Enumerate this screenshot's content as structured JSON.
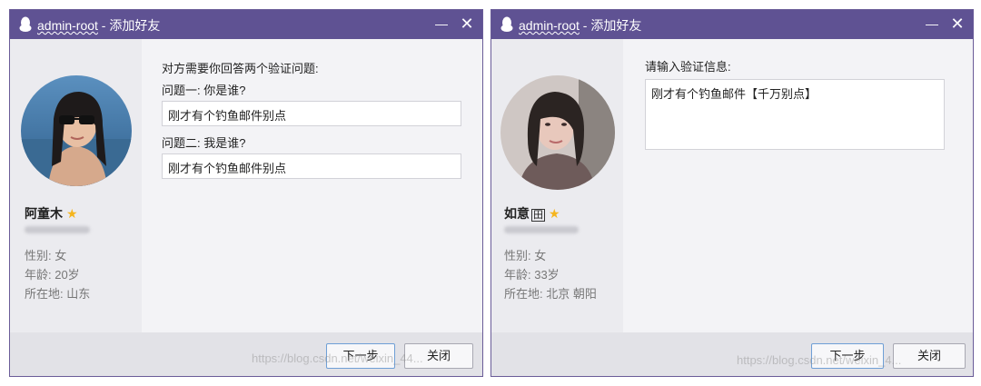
{
  "window_left": {
    "title_account": "admin-root",
    "title_sep": " - ",
    "title_action": "添加好友",
    "minimize_glyph": "—",
    "close_glyph": "✕",
    "profile": {
      "name": "阿童木",
      "star": "★",
      "gender": "性别: 女",
      "age": "年龄: 20岁",
      "location": "所在地:  山东"
    },
    "prompt": "对方需要你回答两个验证问题:",
    "question1_label": "问题一: 你是谁?",
    "question1_answer": "刚才有个钓鱼邮件别点",
    "question2_label": "问题二: 我是谁?",
    "question2_answer": "刚才有个钓鱼邮件别点",
    "next_button": "下一步",
    "close_button": "关闭",
    "watermark": "https://blog.csdn.net/weixin_44..."
  },
  "window_right": {
    "title_account": "admin-root",
    "title_sep": " - ",
    "title_action": "添加好友",
    "minimize_glyph": "—",
    "close_glyph": "✕",
    "profile": {
      "name": "如意",
      "badge": "田",
      "star": "★",
      "gender": "性别: 女",
      "age": "年龄: 33岁",
      "location": "所在地: 北京  朝阳"
    },
    "prompt": "请输入验证信息:",
    "verify_message": "刚才有个钓鱼邮件【千万别点】",
    "next_button": "下一步",
    "close_button": "关闭",
    "watermark": "https://blog.csdn.net/weixin_4..."
  },
  "colors": {
    "titlebar": "#5f5293",
    "star": "#f5b51d",
    "primary_button_border": "#6f9fd6"
  }
}
